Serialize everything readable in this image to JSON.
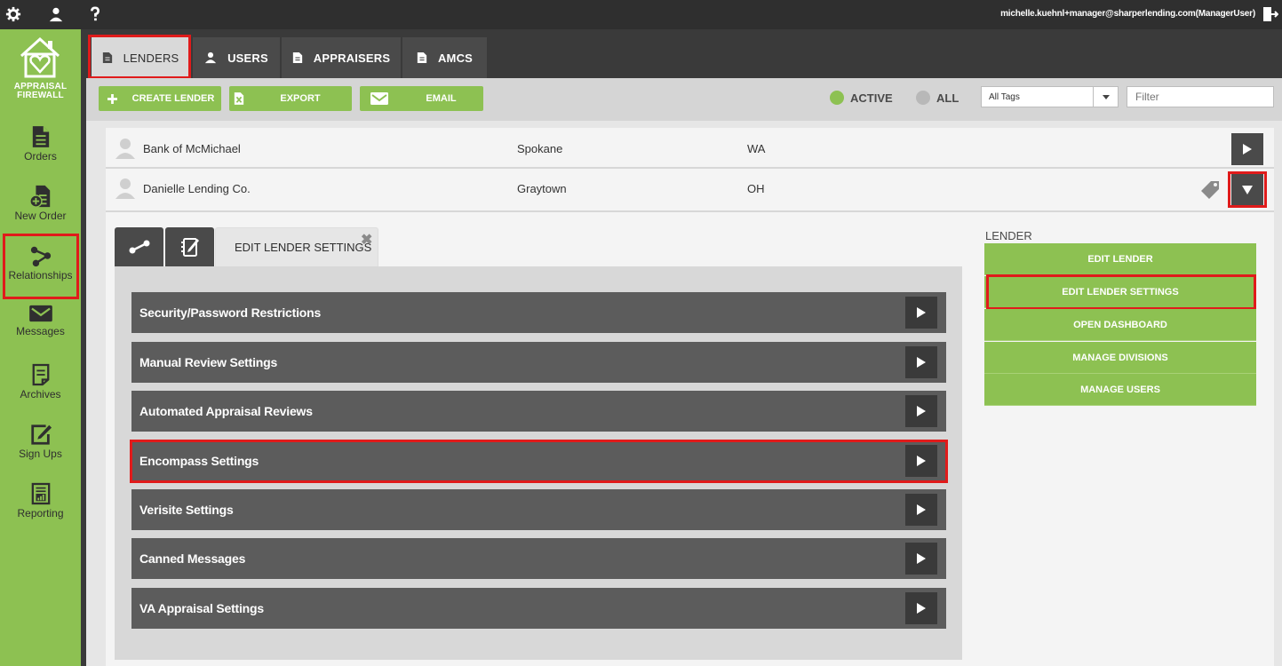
{
  "header": {
    "icons": [
      "gear-icon",
      "user-icon",
      "help-icon",
      "logout-icon"
    ],
    "user_email": "michelle.kuehnl+manager@sharperlending.com(ManagerUser)"
  },
  "logo": {
    "line1": "APPRAISAL",
    "line2": "FIREWALL"
  },
  "sidebar": {
    "items": [
      {
        "label": "Orders",
        "icon": "document-icon"
      },
      {
        "label": "New Order",
        "icon": "new-order-icon"
      },
      {
        "label": "Relationships",
        "icon": "relationships-icon",
        "selected": true
      },
      {
        "label": "Messages",
        "icon": "envelope-icon"
      },
      {
        "label": "Archives",
        "icon": "archive-icon"
      },
      {
        "label": "Sign Ups",
        "icon": "signup-icon"
      },
      {
        "label": "Reporting",
        "icon": "reporting-icon"
      }
    ]
  },
  "tabs": [
    {
      "label": "LENDERS",
      "active": true
    },
    {
      "label": "USERS"
    },
    {
      "label": "APPRAISERS"
    },
    {
      "label": "AMCS"
    }
  ],
  "toolbar": {
    "create_label": "CREATE LENDER",
    "export_label": "EXPORT",
    "email_label": "EMAIL",
    "active_label": "ACTIVE",
    "all_label": "ALL",
    "tags_value": "All Tags",
    "filter_placeholder": "Filter"
  },
  "lenders": [
    {
      "name": "Bank of McMichael",
      "city": "Spokane",
      "state": "WA"
    },
    {
      "name": "Danielle Lending Co.",
      "city": "Graytown",
      "state": "OH"
    }
  ],
  "detail": {
    "active_tab_label": "EDIT LENDER SETTINGS",
    "close_glyph": "✖",
    "settings": [
      "Security/Password Restrictions",
      "Manual Review Settings",
      "Automated Appraisal Reviews",
      "Encompass Settings",
      "Verisite Settings",
      "Canned Messages",
      "VA Appraisal Settings"
    ]
  },
  "lender_panel": {
    "title": "LENDER",
    "actions": [
      "EDIT LENDER",
      "EDIT LENDER SETTINGS",
      "OPEN DASHBOARD",
      "MANAGE DIVISIONS",
      "MANAGE USERS"
    ]
  },
  "colors": {
    "brand_green": "#8dc152",
    "dark": "#2f2f2f",
    "highlight_red": "#e01b1b"
  }
}
